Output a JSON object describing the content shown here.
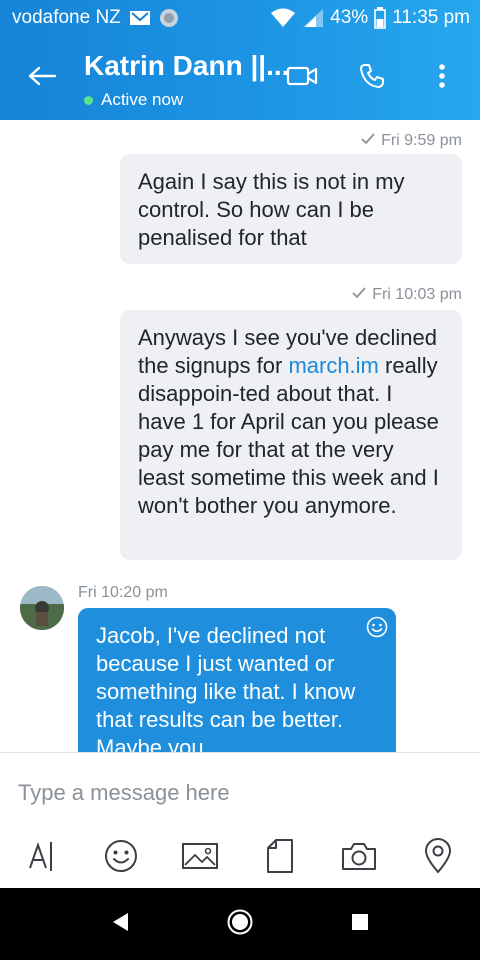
{
  "status_bar": {
    "carrier": "vodafone NZ",
    "battery_percent": "43%",
    "time": "11:35 pm",
    "icons": [
      "mail-icon",
      "sync-icon",
      "wifi-icon",
      "cell-signal-icon",
      "battery-icon"
    ]
  },
  "header": {
    "contact_name": "Katrin Dann ||...",
    "presence": "Active now",
    "presence_color": "#5be28b",
    "icons": [
      "back-arrow-icon",
      "video-call-icon",
      "phone-call-icon",
      "more-vert-icon"
    ]
  },
  "messages": [
    {
      "direction": "outgoing",
      "timestamp": "Fri 9:59 pm",
      "text": "Again I say this is not in my control. So how can I be penalised for that"
    },
    {
      "direction": "outgoing",
      "timestamp": "Fri 10:03 pm",
      "text_before_link": "Anyways I see you've declined the signups for ",
      "link": "march.im",
      "text_after_link": " really disappoin-ted about that. I have 1 for April can you please pay me for that at the very least sometime this week and I won't bother you anymore."
    },
    {
      "direction": "incoming",
      "timestamp": "Fri 10:20 pm",
      "text": "Jacob, I've declined not because I just wanted or something like that. I know that results can be better. Maybe you"
    }
  ],
  "composer": {
    "placeholder": "Type a message here",
    "value": "",
    "tools": [
      "text-format-icon",
      "emoji-icon",
      "image-icon",
      "file-icon",
      "camera-icon",
      "location-icon"
    ]
  },
  "nav_bar": {
    "icons": [
      "back-triangle-icon",
      "home-circle-icon",
      "recents-square-icon"
    ]
  },
  "colors": {
    "header_start": "#1683d6",
    "header_end": "#27a7ee",
    "outgoing_bubble": "#eff0f3",
    "incoming_bubble": "#1f8fdd",
    "link": "#1c8ad8"
  }
}
